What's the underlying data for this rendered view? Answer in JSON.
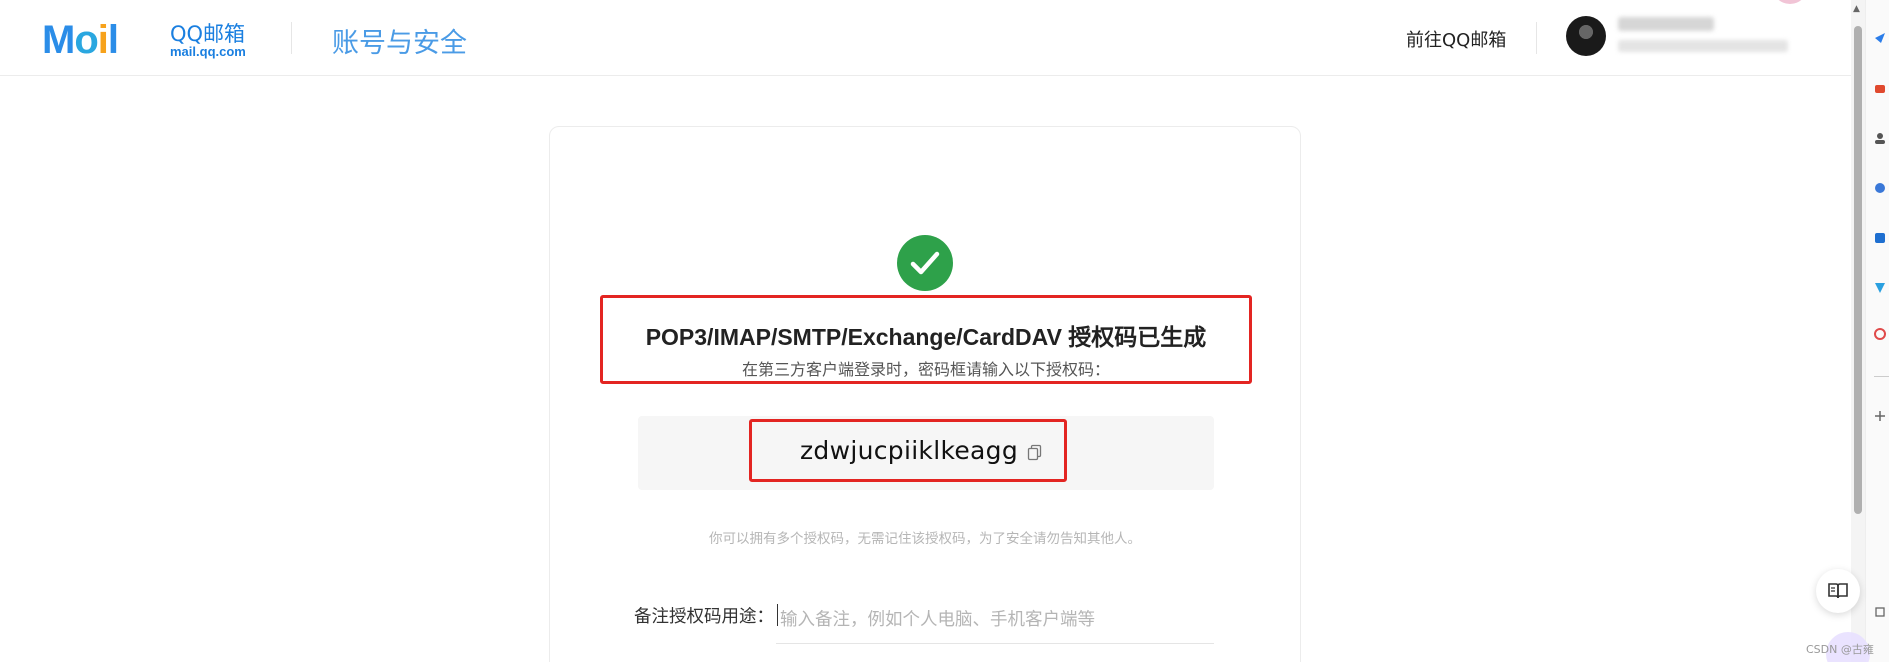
{
  "header": {
    "logo_letters": [
      "M",
      "o",
      "i",
      "l"
    ],
    "brand_cn": "QQ邮箱",
    "brand_domain": "mail.qq.com",
    "page_title": "账号与安全",
    "goto_link": "前往QQ邮箱"
  },
  "card": {
    "title": "POP3/IMAP/SMTP/Exchange/CardDAV 授权码已生成",
    "subtitle": "在第三方客户端登录时，密码框请输入以下授权码：",
    "auth_code": "zdwjucpiiklkeagg",
    "note": "你可以拥有多个授权码，无需记住该授权码，为了安全请勿告知其他人。",
    "remark_label": "备注授权码用途：",
    "remark_placeholder": "输入备注，例如个人电脑、手机客户端等",
    "remark_value": ""
  },
  "watermark": "CSDN @古雍",
  "colors": {
    "brand_blue": "#1a7fe0",
    "title_blue": "#4a9be6",
    "success_green": "#2ea14a",
    "highlight_red": "#e32522"
  },
  "icons": [
    "check-circle-icon",
    "copy-icon",
    "book-icon",
    "avatar",
    "scroll-up-arrow-icon"
  ]
}
